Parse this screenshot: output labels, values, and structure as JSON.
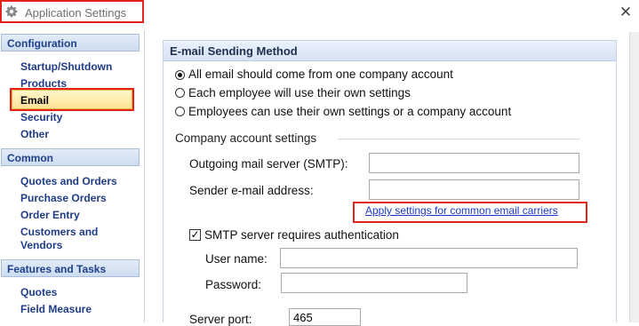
{
  "window": {
    "title": "Application Settings",
    "icons": {
      "app": "gear-icon",
      "close": "close-icon"
    },
    "close_glyph": "✕"
  },
  "sidebar": {
    "sections": [
      {
        "header": "Configuration",
        "items": [
          "Startup/Shutdown",
          "Products",
          "Email",
          "Security",
          "Other"
        ]
      },
      {
        "header": "Common",
        "items": [
          "Quotes and Orders",
          "Purchase Orders",
          "Order Entry",
          "Customers and",
          "Vendors"
        ]
      },
      {
        "header": "Features and Tasks",
        "items": [
          "Quotes",
          "Field Measure"
        ]
      }
    ],
    "selected_item": "Email"
  },
  "main": {
    "section_title": "E-mail Sending Method",
    "sending_options": [
      {
        "label": "All email should come from one company account",
        "selected": true
      },
      {
        "label": "Each employee will use their own settings",
        "selected": false
      },
      {
        "label": "Employees can use their own settings or a company account",
        "selected": false
      }
    ],
    "company_group_label": "Company account settings",
    "smtp_server_label": "Outgoing mail server (SMTP):",
    "smtp_server_value": "",
    "sender_label": "Sender e-mail address:",
    "sender_value": "",
    "apply_link": "Apply settings for common email carriers",
    "auth_checkbox_label": "SMTP server requires authentication",
    "auth_checked": true,
    "check_glyph": "✓",
    "username_label": "User name:",
    "username_value": "",
    "password_label": "Password:",
    "password_value": "",
    "port_label": "Server port:",
    "port_value": "465"
  },
  "colors": {
    "highlight_outline": "#e2231a",
    "nav_text": "#1f3c88",
    "link": "#1a38c8"
  }
}
